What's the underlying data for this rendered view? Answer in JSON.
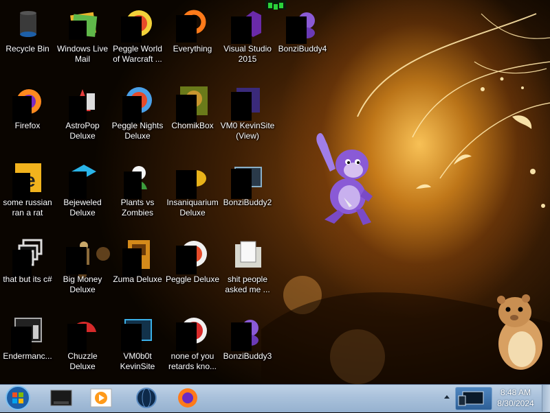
{
  "desktop": {
    "icons": [
      {
        "label": "Recycle Bin",
        "icon": "recycle-bin-icon"
      },
      {
        "label": "Windows Live Mail",
        "icon": "mail-icon"
      },
      {
        "label": "Peggle World of Warcraft ...",
        "icon": "peggle-icon"
      },
      {
        "label": "Everything",
        "icon": "search-ring-icon"
      },
      {
        "label": "Visual Studio 2015",
        "icon": "visual-studio-icon"
      },
      {
        "label": "BonziBuddy4",
        "icon": "bonzi-icon"
      },
      {
        "label": "Firefox",
        "icon": "firefox-icon"
      },
      {
        "label": "AstroPop Deluxe",
        "icon": "astropop-icon"
      },
      {
        "label": "Peggle Nights Deluxe",
        "icon": "peggle-icon"
      },
      {
        "label": "ChomikBox",
        "icon": "chomikbox-icon"
      },
      {
        "label": "VM0 KevinSite (View)",
        "icon": "vm-icon"
      },
      {
        "label": "some russian ran a rat",
        "icon": "yellow-doc-icon"
      },
      {
        "label": "Bejeweled Deluxe",
        "icon": "bejeweled-icon"
      },
      {
        "label": "Plants vs Zombies",
        "icon": "plants-icon"
      },
      {
        "label": "Insaniquarium Deluxe",
        "icon": "fish-icon"
      },
      {
        "label": "BonziBuddy2",
        "icon": "monitor-icon"
      },
      {
        "label": "that but its c#",
        "icon": "windows-stack-icon"
      },
      {
        "label": "Big Money Deluxe",
        "icon": "money-icon"
      },
      {
        "label": "Zuma Deluxe",
        "icon": "zuma-icon"
      },
      {
        "label": "Peggle Deluxe",
        "icon": "peggle-icon"
      },
      {
        "label": "shit people asked me ...",
        "icon": "folder-icon"
      },
      {
        "label": "Endermanc...",
        "icon": "terminal-icon"
      },
      {
        "label": "Chuzzle Deluxe",
        "icon": "chuzzle-icon"
      },
      {
        "label": "VM0b0t KevinSite",
        "icon": "vm-icon"
      },
      {
        "label": "none of you retards kno...",
        "icon": "red-ball-icon"
      },
      {
        "label": "BonziBuddy3",
        "icon": "bonzi-icon"
      }
    ]
  },
  "taskbar": {
    "pinned": [
      {
        "icon": "window-manager-icon"
      },
      {
        "icon": "media-player-icon"
      },
      {
        "icon": "globe-icon"
      },
      {
        "icon": "firefox-icon"
      }
    ],
    "clock": {
      "time": "8:48 AM",
      "date": "8/30/2024"
    }
  },
  "colors": {
    "taskbar": "#a9c1db",
    "label_text": "#ffffff",
    "wallpaper_glow": "#f0b040"
  }
}
